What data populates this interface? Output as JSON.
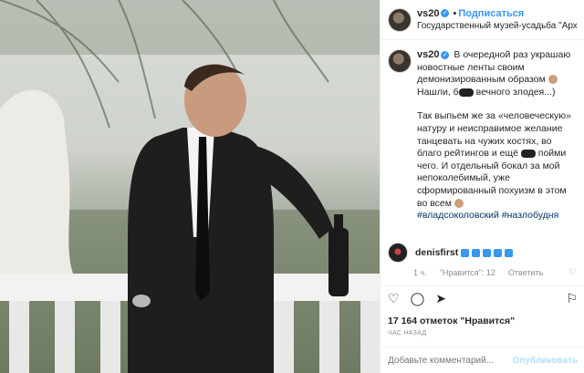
{
  "header": {
    "username": "vs20",
    "follow_label": "Подписаться",
    "location": "Государственный музей-усадьба \"Архангельс..."
  },
  "caption": {
    "username": "vs20",
    "paragraph1": "В очередной раз украшаю новостные ленты своим демонизированным образом",
    "paragraph1_tail": "Нашли, б",
    "paragraph1_end": "вечного злодея...)",
    "paragraph2_a": "Так выпьем же за «человеческую» натуру и неисправимое желание танцевать на чужих костях, во благо рейтингов и ещё",
    "paragraph2_b": "пойми чего. И отдельный бокал за мой непоколебимый, уже сформированный похуизм в этом во всем",
    "hashtags": "#владсоколовский #назлобудня"
  },
  "comment": {
    "username": "denisfirst",
    "time": "1 ч.",
    "likes": "\"Нравится\": 12",
    "reply": "Ответить"
  },
  "actions": {
    "like_icon": "heart-icon",
    "comment_icon": "comment-icon",
    "share_icon": "share-icon",
    "save_icon": "bookmark-icon"
  },
  "likes_text": "17 164 отметок \"Нравится\"",
  "timestamp": "ЧАС НАЗАД",
  "add_comment": {
    "placeholder": "Добавьте комментарий...",
    "publish_label": "Опубликовать"
  },
  "colors": {
    "accent": "#3897f0",
    "hashtag": "#003569",
    "muted": "#8e8e8e"
  }
}
